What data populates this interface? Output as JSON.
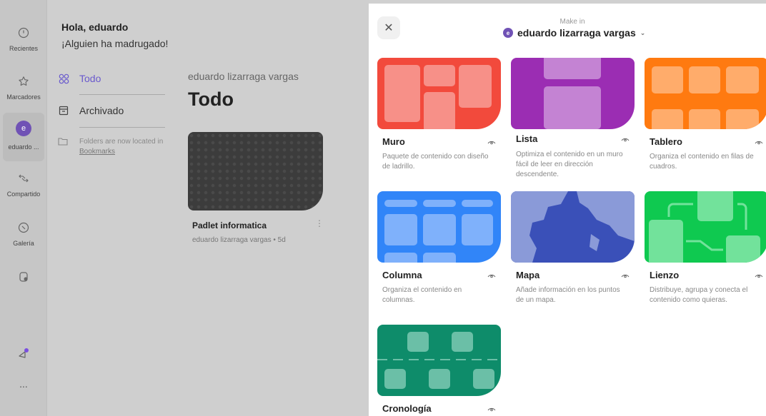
{
  "rail": {
    "items": [
      {
        "label": "Recientes",
        "icon": "clock-icon"
      },
      {
        "label": "Marcadores",
        "icon": "star-icon"
      },
      {
        "label": "eduardo ...",
        "icon": "avatar",
        "avatar_letter": "e"
      },
      {
        "label": "Compartido",
        "icon": "handshake-icon"
      },
      {
        "label": "Galería",
        "icon": "compass-icon"
      },
      {
        "label": "",
        "icon": "add-file-icon"
      }
    ],
    "bottom": {
      "announce_icon": "megaphone-icon",
      "more": "..."
    }
  },
  "main": {
    "greeting": "Hola, eduardo",
    "subgreeting": "¡Alguien ha madrugado!",
    "nav": [
      {
        "label": "Todo",
        "icon": "grid-icon",
        "active": true
      },
      {
        "label": "Archivado",
        "icon": "archive-icon",
        "active": false
      }
    ],
    "folders_note": {
      "text": "Folders are now located in ",
      "link": "Bookmarks"
    },
    "owner": "eduardo lizarraga vargas",
    "title": "Todo",
    "padlet": {
      "title": "Padlet informatica",
      "meta": "eduardo lizarraga vargas • 5d",
      "more": "⋮"
    }
  },
  "panel": {
    "close": "✕",
    "make_in": "Make in",
    "owner": "eduardo lizarraga vargas",
    "owner_letter": "e",
    "cards": [
      {
        "title": "Muro",
        "desc": "Paquete de contenido con diseño de ladrillo.",
        "color": "#f24a3c"
      },
      {
        "title": "Lista",
        "desc": "Optimiza el contenido en un muro fácil de leer en dirección descendente.",
        "color": "#9b2db3"
      },
      {
        "title": "Tablero",
        "desc": "Organiza el contenido en filas de cuadros.",
        "color": "#ff7a10"
      },
      {
        "title": "Columna",
        "desc": "Organiza el contenido en columnas.",
        "color": "#3185f8"
      },
      {
        "title": "Mapa",
        "desc": "Añade información en los puntos de un mapa.",
        "color": "#3a50b8"
      },
      {
        "title": "Lienzo",
        "desc": "Distribuye, agrupa y conecta el contenido como quieras.",
        "color": "#0fc950"
      },
      {
        "title": "Cronología",
        "desc": "",
        "color": "#0e8c6a"
      }
    ]
  }
}
